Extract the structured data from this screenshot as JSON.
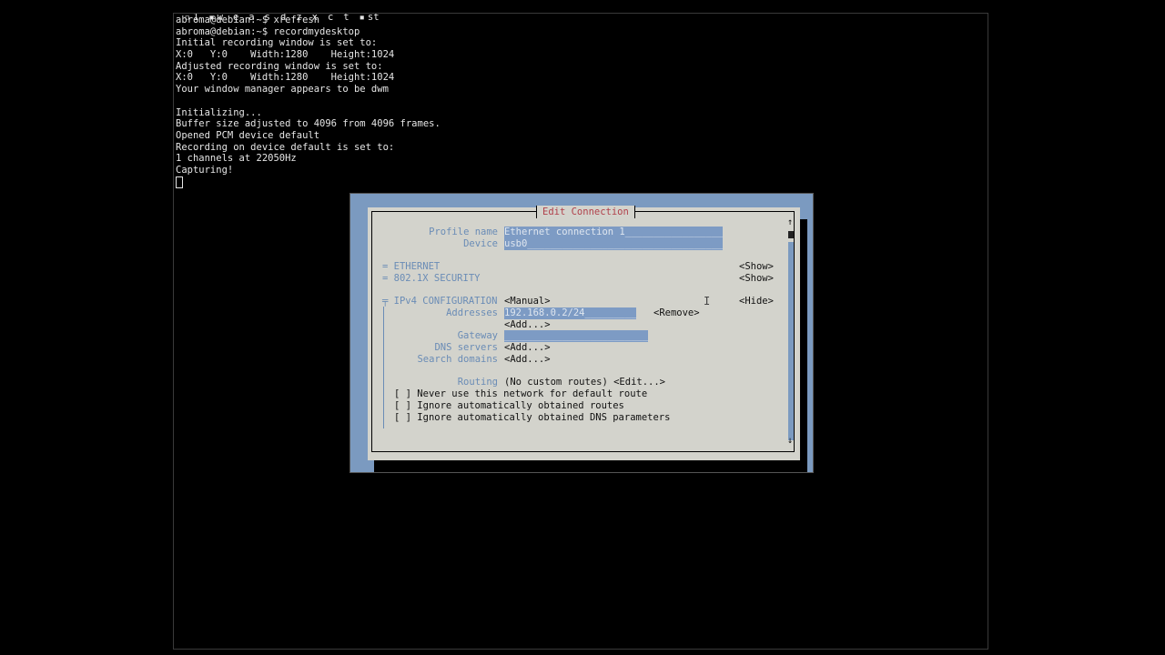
{
  "tagbar": {
    "tags": [
      "1",
      "w",
      "e",
      "a",
      "s",
      "d",
      "z",
      "x",
      "c",
      "t",
      "st"
    ]
  },
  "terminal": {
    "lines": [
      {
        "prompt": "abroma@debian:~$ ",
        "text": "xrefresh"
      },
      {
        "prompt": "abroma@debian:~$ ",
        "text": "recordmydesktop"
      },
      {
        "prompt": "",
        "text": "Initial recording window is set to:"
      },
      {
        "prompt": "",
        "text": "X:0   Y:0    Width:1280    Height:1024"
      },
      {
        "prompt": "",
        "text": "Adjusted recording window is set to:"
      },
      {
        "prompt": "",
        "text": "X:0   Y:0    Width:1280    Height:1024"
      },
      {
        "prompt": "",
        "text": "Your window manager appears to be dwm"
      },
      {
        "prompt": "",
        "text": ""
      },
      {
        "prompt": "",
        "text": "Initializing..."
      },
      {
        "prompt": "",
        "text": "Buffer size adjusted to 4096 from 4096 frames."
      },
      {
        "prompt": "",
        "text": "Opened PCM device default"
      },
      {
        "prompt": "",
        "text": "Recording on device default is set to:"
      },
      {
        "prompt": "",
        "text": "1 channels at 22050Hz"
      },
      {
        "prompt": "",
        "text": "Capturing!"
      }
    ]
  },
  "dialog": {
    "title": "Edit Connection",
    "profile_name_label": "Profile name",
    "profile_name_value": "Ethernet connection 1_________________",
    "device_label": "Device",
    "device_value": "usb0__________________________________",
    "ethernet_label": "= ETHERNET",
    "ethernet_show": "<Show>",
    "security_label": "= 802.1X SECURITY",
    "security_show": "<Show>",
    "ipv4_label": "╤ IPv4 CONFIGURATION",
    "ipv4_mode": "<Manual>",
    "ipv4_hide": "<Hide>",
    "addresses_label": "Addresses",
    "address_value": "192.168.0.2/24_________",
    "remove_button": "<Remove>",
    "add_address": "<Add...>",
    "gateway_label": "Gateway",
    "gateway_value": "_________________________",
    "dns_label": "DNS servers",
    "dns_add": "<Add...>",
    "search_label": "Search domains",
    "search_add": "<Add...>",
    "routing_label": "Routing",
    "routing_value": "(No custom routes) <Edit...>",
    "checkboxes": [
      {
        "box": "[ ]",
        "label": "Never use this network for default route"
      },
      {
        "box": "[ ]",
        "label": "Ignore automatically obtained routes"
      },
      {
        "box": "[ ]",
        "label": "Ignore automatically obtained DNS parameters"
      }
    ],
    "scroll_up": "↑",
    "scroll_down": "↓"
  }
}
